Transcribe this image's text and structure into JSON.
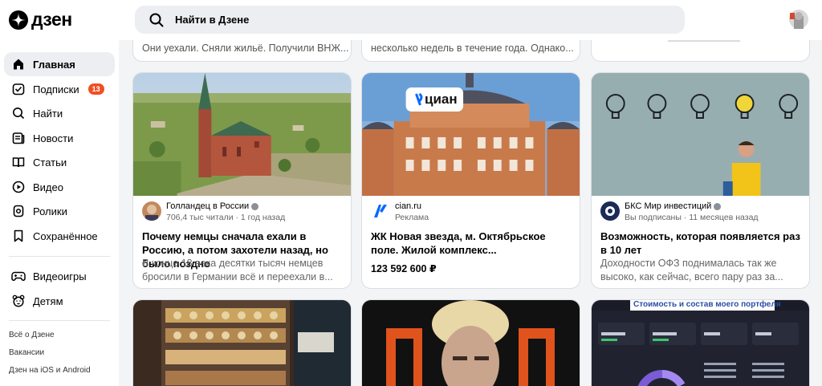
{
  "header": {
    "logo_text": "дзен",
    "search_placeholder": "Найти в Дзене"
  },
  "sidebar": {
    "items": [
      {
        "label": "Главная",
        "icon": "home-icon"
      },
      {
        "label": "Подписки",
        "icon": "subscriptions-icon",
        "badge": "13"
      },
      {
        "label": "Найти",
        "icon": "search-icon"
      },
      {
        "label": "Новости",
        "icon": "news-icon"
      },
      {
        "label": "Статьи",
        "icon": "articles-icon"
      },
      {
        "label": "Видео",
        "icon": "video-icon"
      },
      {
        "label": "Ролики",
        "icon": "clips-icon"
      },
      {
        "label": "Сохранённое",
        "icon": "bookmark-icon"
      },
      {
        "label": "Видеоигры",
        "icon": "gamepad-icon"
      },
      {
        "label": "Детям",
        "icon": "kids-icon"
      }
    ],
    "footer_links": [
      "Всё о Дзене",
      "Вакансии",
      "Дзен на iOS и Android"
    ]
  },
  "feed": {
    "top_row": [
      "Они уехали. Сняли жильё. Получили ВНЖ...",
      "несколько недель в течение года. Однако..."
    ],
    "cards": [
      {
        "author": "Голландец в России",
        "meta": "706,4 тыс читали · 1 год назад",
        "title": "Почему немцы сначала ехали в Россию, а потом захотели назад, но было поздно",
        "desc": "В конце 18 века десятки тысяч немцев бросили в Германии всё и переехали в..."
      },
      {
        "author": "cian.ru",
        "meta": "Реклама",
        "brand": "циан",
        "title": "ЖК Новая звезда, м. Октябрьское поле. Жилой комплекс...",
        "price": "123 592 600 ₽"
      },
      {
        "author": "БКС Мир инвестиций",
        "meta": "Вы подписаны · 11 месяцев назад",
        "title": "Возможность, которая появляется раз в 10 лет",
        "desc": "Доходности ОФЗ поднималась так же высоко, как сейчас, всего пару раз за..."
      }
    ],
    "bottom_row": {
      "portfolio_caption": "Стоимость и состав моего портфеля"
    }
  },
  "colors": {
    "accent": "#f04f24",
    "cian_blue": "#0468ff",
    "page_bg": "#f3f4f6"
  }
}
